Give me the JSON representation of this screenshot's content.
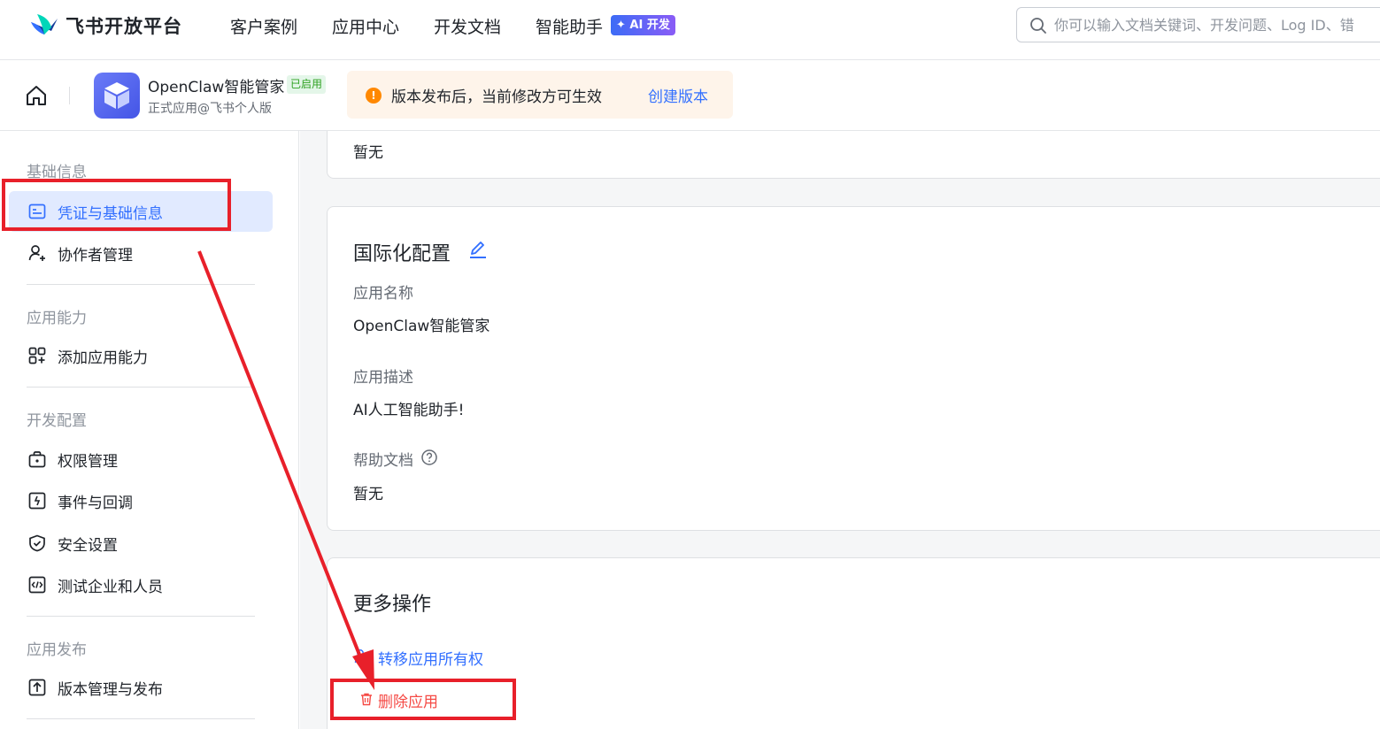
{
  "brand": {
    "name": "飞书开放平台"
  },
  "nav": {
    "items": [
      "客户案例",
      "应用中心",
      "开发文档",
      "智能助手"
    ],
    "ai_badge": "✦ AI 开发"
  },
  "search": {
    "placeholder": "你可以输入文档关键词、开发问题、Log ID、错"
  },
  "app": {
    "name": "OpenClaw智能管家",
    "status": "已启用",
    "subtitle": "正式应用@飞书个人版"
  },
  "notice": {
    "text": "版本发布后，当前修改方可生效",
    "action": "创建版本",
    "icon": "!"
  },
  "sidebar": {
    "sections": [
      {
        "title": "基础信息",
        "items": [
          {
            "label": "凭证与基础信息",
            "icon": "credential-icon",
            "active": true
          },
          {
            "label": "协作者管理",
            "icon": "user-add-icon"
          }
        ]
      },
      {
        "title": "应用能力",
        "items": [
          {
            "label": "添加应用能力",
            "icon": "grid-add-icon"
          }
        ]
      },
      {
        "title": "开发配置",
        "items": [
          {
            "label": "权限管理",
            "icon": "permission-icon"
          },
          {
            "label": "事件与回调",
            "icon": "event-icon"
          },
          {
            "label": "安全设置",
            "icon": "shield-icon"
          },
          {
            "label": "测试企业和人员",
            "icon": "code-icon"
          }
        ]
      },
      {
        "title": "应用发布",
        "items": [
          {
            "label": "版本管理与发布",
            "icon": "upload-icon"
          }
        ]
      }
    ]
  },
  "main": {
    "top_card_value": "暂无",
    "i18n": {
      "title": "国际化配置",
      "app_name_label": "应用名称",
      "app_name_value": "OpenClaw智能管家",
      "desc_label": "应用描述",
      "desc_value": "AI人工智能助手!",
      "help_label": "帮助文档",
      "help_value": "暂无"
    },
    "more": {
      "title": "更多操作",
      "transfer": "转移应用所有权",
      "delete": "删除应用"
    }
  },
  "colors": {
    "accent": "#3370ff",
    "danger": "#f54a45",
    "annotation": "#e8202a",
    "warning": "#ff8800"
  }
}
